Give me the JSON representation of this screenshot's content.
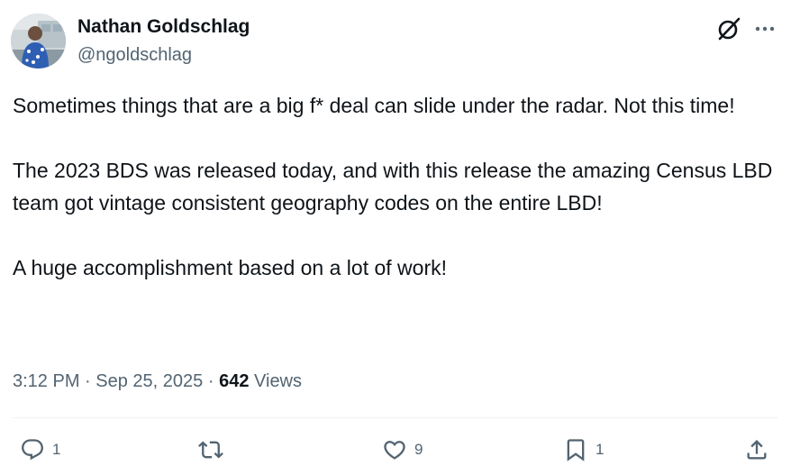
{
  "author": {
    "name": "Nathan Goldschlag",
    "handle": "@ngoldschlag"
  },
  "icons": {
    "grok": "grok-icon",
    "more": "more-options-icon",
    "reply": "reply-icon",
    "retweet": "retweet-icon",
    "like": "heart-icon",
    "bookmark": "bookmark-icon",
    "share": "share-icon"
  },
  "tweet": {
    "paragraphs": [
      "Sometimes things that are a big f* deal can slide under the radar. Not this time!",
      "The 2023 BDS was released today, and with this release the amazing Census LBD team got vintage consistent geography codes on the entire LBD!",
      "A huge accomplishment based on a lot of work!"
    ],
    "time": "3:12 PM",
    "separator": "·",
    "date": "Sep 25, 2025",
    "views_count": "642",
    "views_label": "Views"
  },
  "actions": {
    "reply_count": "1",
    "retweet_count": "",
    "like_count": "9",
    "bookmark_count": "1"
  },
  "colors": {
    "text_primary": "#0f1419",
    "text_secondary": "#536471",
    "divider": "#eff3f4"
  }
}
